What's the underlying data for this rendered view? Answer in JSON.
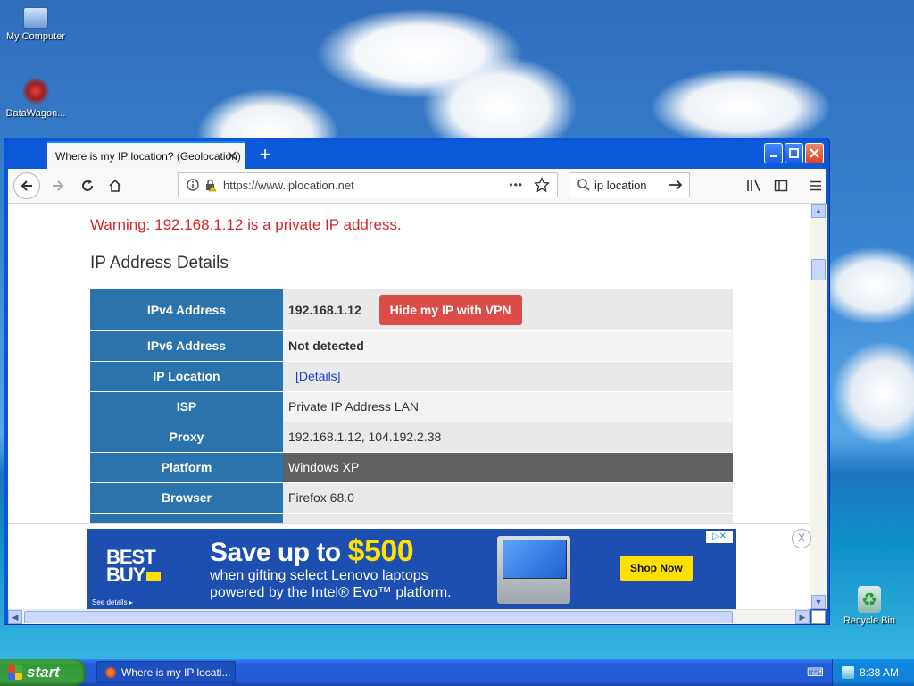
{
  "desktop": {
    "icons": [
      {
        "label": "My Computer"
      },
      {
        "label": "DataWagon..."
      },
      {
        "label": "Recycle Bin"
      }
    ]
  },
  "browser": {
    "tab_title": "Where is my IP location? (Geolocation)",
    "tab_close": "✕",
    "new_tab": "+",
    "url": "https://www.iplocation.net",
    "url_menu": "•••",
    "search_text": "ip location"
  },
  "page": {
    "warning": "Warning: 192.168.1.12 is a private IP address.",
    "section_title": "IP Address Details",
    "rows": [
      {
        "label": "IPv4 Address",
        "value": "192.168.1.12"
      },
      {
        "label": "IPv6 Address",
        "value": "Not detected"
      },
      {
        "label": "IP Location",
        "value": "[Details]"
      },
      {
        "label": "ISP",
        "value": "Private IP Address LAN"
      },
      {
        "label": "Proxy",
        "value": "192.168.1.12, 104.192.2.38"
      },
      {
        "label": "Platform",
        "value": "Windows XP"
      },
      {
        "label": "Browser",
        "value": "Firefox 68.0"
      }
    ],
    "vpn_button": "Hide my IP with VPN"
  },
  "ad": {
    "logo_line1": "BEST",
    "logo_line2": "BUY",
    "headline": "Save up to ",
    "price": "$500",
    "sub1": "when gifting select Lenovo laptops",
    "sub2": "powered by the Intel® Evo™ platform.",
    "see_details": "See details ▸",
    "shop_now": "Shop Now",
    "close": "X",
    "adchoices": "▷✕"
  },
  "taskbar": {
    "start": "start",
    "task_title": "Where is my IP locati...",
    "clock": "8:38 AM"
  }
}
